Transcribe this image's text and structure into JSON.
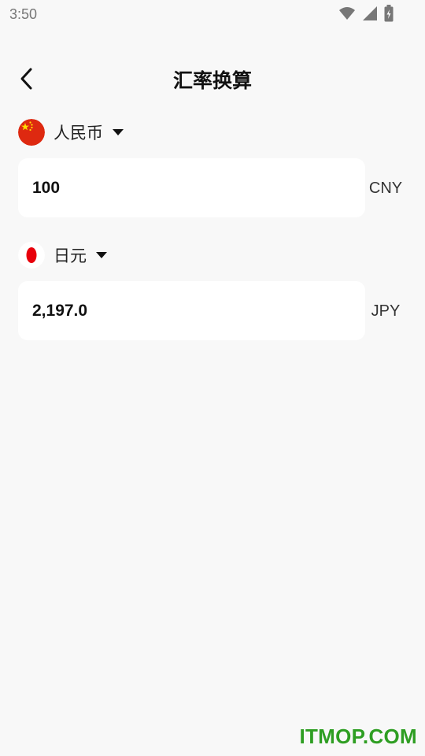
{
  "status_bar": {
    "time": "3:50",
    "icons": [
      "wifi-icon",
      "cellular-signal-icon",
      "battery-charging-icon"
    ]
  },
  "header": {
    "title": "汇率换算",
    "back_icon": "chevron-left-icon"
  },
  "from_currency": {
    "name": "人民币",
    "flag": "china-flag-icon",
    "amount": "100",
    "code": "CNY"
  },
  "to_currency": {
    "name": "日元",
    "flag": "japan-flag-icon",
    "amount": "2,197.0",
    "code": "JPY"
  },
  "watermark": "ITMOP.COM",
  "colors": {
    "background": "#f8f8f8",
    "card": "#ffffff",
    "china_red": "#de2910",
    "china_yellow": "#ffde00",
    "japan_red": "#e8000b",
    "watermark_green": "#2e9e22"
  }
}
